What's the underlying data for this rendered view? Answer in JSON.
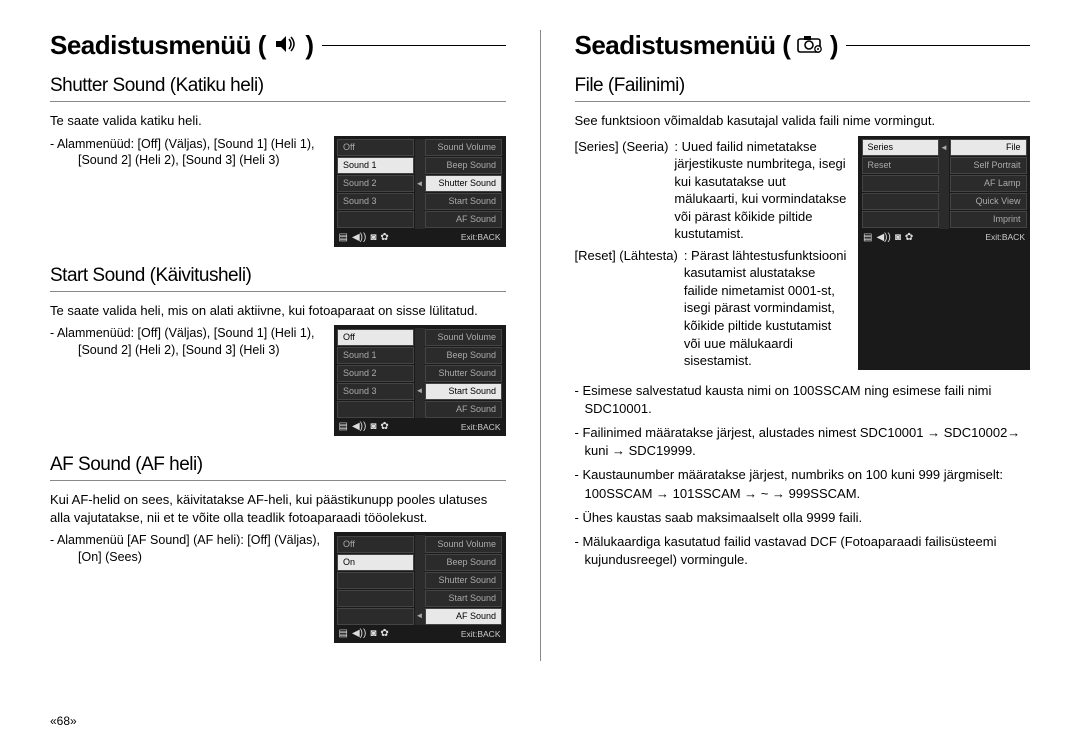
{
  "page_number": "«68»",
  "left": {
    "title": "Seadistusmenüü (",
    "title_close": ")",
    "icon_name": "sound-speaker-icon",
    "sections": [
      {
        "heading": "Shutter Sound (Katiku heli)",
        "body": "Te saate valida katiku heli.",
        "submenu_lead": "- Alammenüüd: [Off] (Väljas), [Sound 1] (Heli 1),",
        "submenu_indent": "[Sound 2] (Heli 2), [Sound 3]  (Heli 3)",
        "lcd": {
          "left": [
            "Off",
            "Sound 1",
            "Sound 2",
            "Sound 3",
            ""
          ],
          "right": [
            "Sound Volume",
            "Beep Sound",
            "Shutter Sound",
            "Start Sound",
            "AF Sound"
          ],
          "sel_left": 1,
          "sel_right": 2,
          "caret_row": 2,
          "exit": "Exit:BACK"
        }
      },
      {
        "heading": "Start Sound (Käivitusheli)",
        "body": "Te saate valida heli, mis on alati aktiivne, kui fotoaparaat on sisse lülitatud.",
        "submenu_lead": "- Alammenüüd: [Off] (Väljas), [Sound 1] (Heli 1),",
        "submenu_indent": "[Sound 2] (Heli 2), [Sound 3]  (Heli 3)",
        "lcd": {
          "left": [
            "Off",
            "Sound 1",
            "Sound 2",
            "Sound 3",
            ""
          ],
          "right": [
            "Sound Volume",
            "Beep Sound",
            "Shutter Sound",
            "Start Sound",
            "AF Sound"
          ],
          "sel_left": 0,
          "sel_right": 3,
          "caret_row": 3,
          "exit": "Exit:BACK"
        }
      },
      {
        "heading": "AF Sound (AF heli)",
        "body": "Kui AF-helid on sees, käivitatakse AF-heli, kui päästikunupp pooles ulatuses alla vajutatakse, nii et te võite olla teadlik fotoaparaadi tööolekust.",
        "submenu_lead": "- Alammenüü [AF Sound] (AF heli): [Off] (Väljas),",
        "submenu_indent": "[On] (Sees)",
        "lcd": {
          "left": [
            "Off",
            "On",
            "",
            "",
            ""
          ],
          "right": [
            "Sound Volume",
            "Beep Sound",
            "Shutter Sound",
            "Start Sound",
            "AF Sound"
          ],
          "sel_left": 1,
          "sel_right": 4,
          "caret_row": 4,
          "exit": "Exit:BACK"
        }
      }
    ]
  },
  "right": {
    "title": "Seadistusmenüü (",
    "title_close": ")",
    "icon_name": "camera-setup-icon",
    "heading": "File (Failinimi)",
    "body": "See funktsioon võimaldab kasutajal valida faili nime vormingut.",
    "defs": {
      "series_label": "[Series] (Seeria)",
      "series_body": ": Uued failid nimetatakse järjestikuste numbritega, isegi kui kasutatakse uut mälukaarti, kui vormindatakse või pärast kõikide piltide kustutamist.",
      "reset_label": "[Reset] (Lähtesta)",
      "reset_body": ": Pärast lähtestusfunktsiooni kasutamist alustatakse failide nimetamist 0001-st, isegi pärast vormindamist, kõikide piltide kustutamist või uue mälukaardi sisestamist."
    },
    "lcd": {
      "left": [
        "Series",
        "Reset",
        "",
        "",
        ""
      ],
      "right": [
        "File",
        "Self Portrait",
        "AF Lamp",
        "Quick View",
        "Imprint"
      ],
      "sel_left": 0,
      "sel_right": 0,
      "caret_row": 0,
      "exit": "Exit:BACK"
    },
    "notes": [
      "- Esimese salvestatud kausta nimi on 100SSCAM ning esimese faili nimi SDC10001.",
      "- Failinimed määratakse järjest, alustades nimest SDC10001 → SDC10002→ kuni → SDC19999.",
      "- Kaustaunumber määratakse järjest, numbriks on 100 kuni 999 järgmiselt: 100SSCAM → 101SSCAM → ~ → 999SSCAM.",
      "- Ühes kaustas saab maksimaalselt olla 9999 faili.",
      "- Mälukaardiga kasutatud failid vastavad DCF (Fotoaparaadi failisüsteemi kujundusreegel) vormingule."
    ]
  }
}
